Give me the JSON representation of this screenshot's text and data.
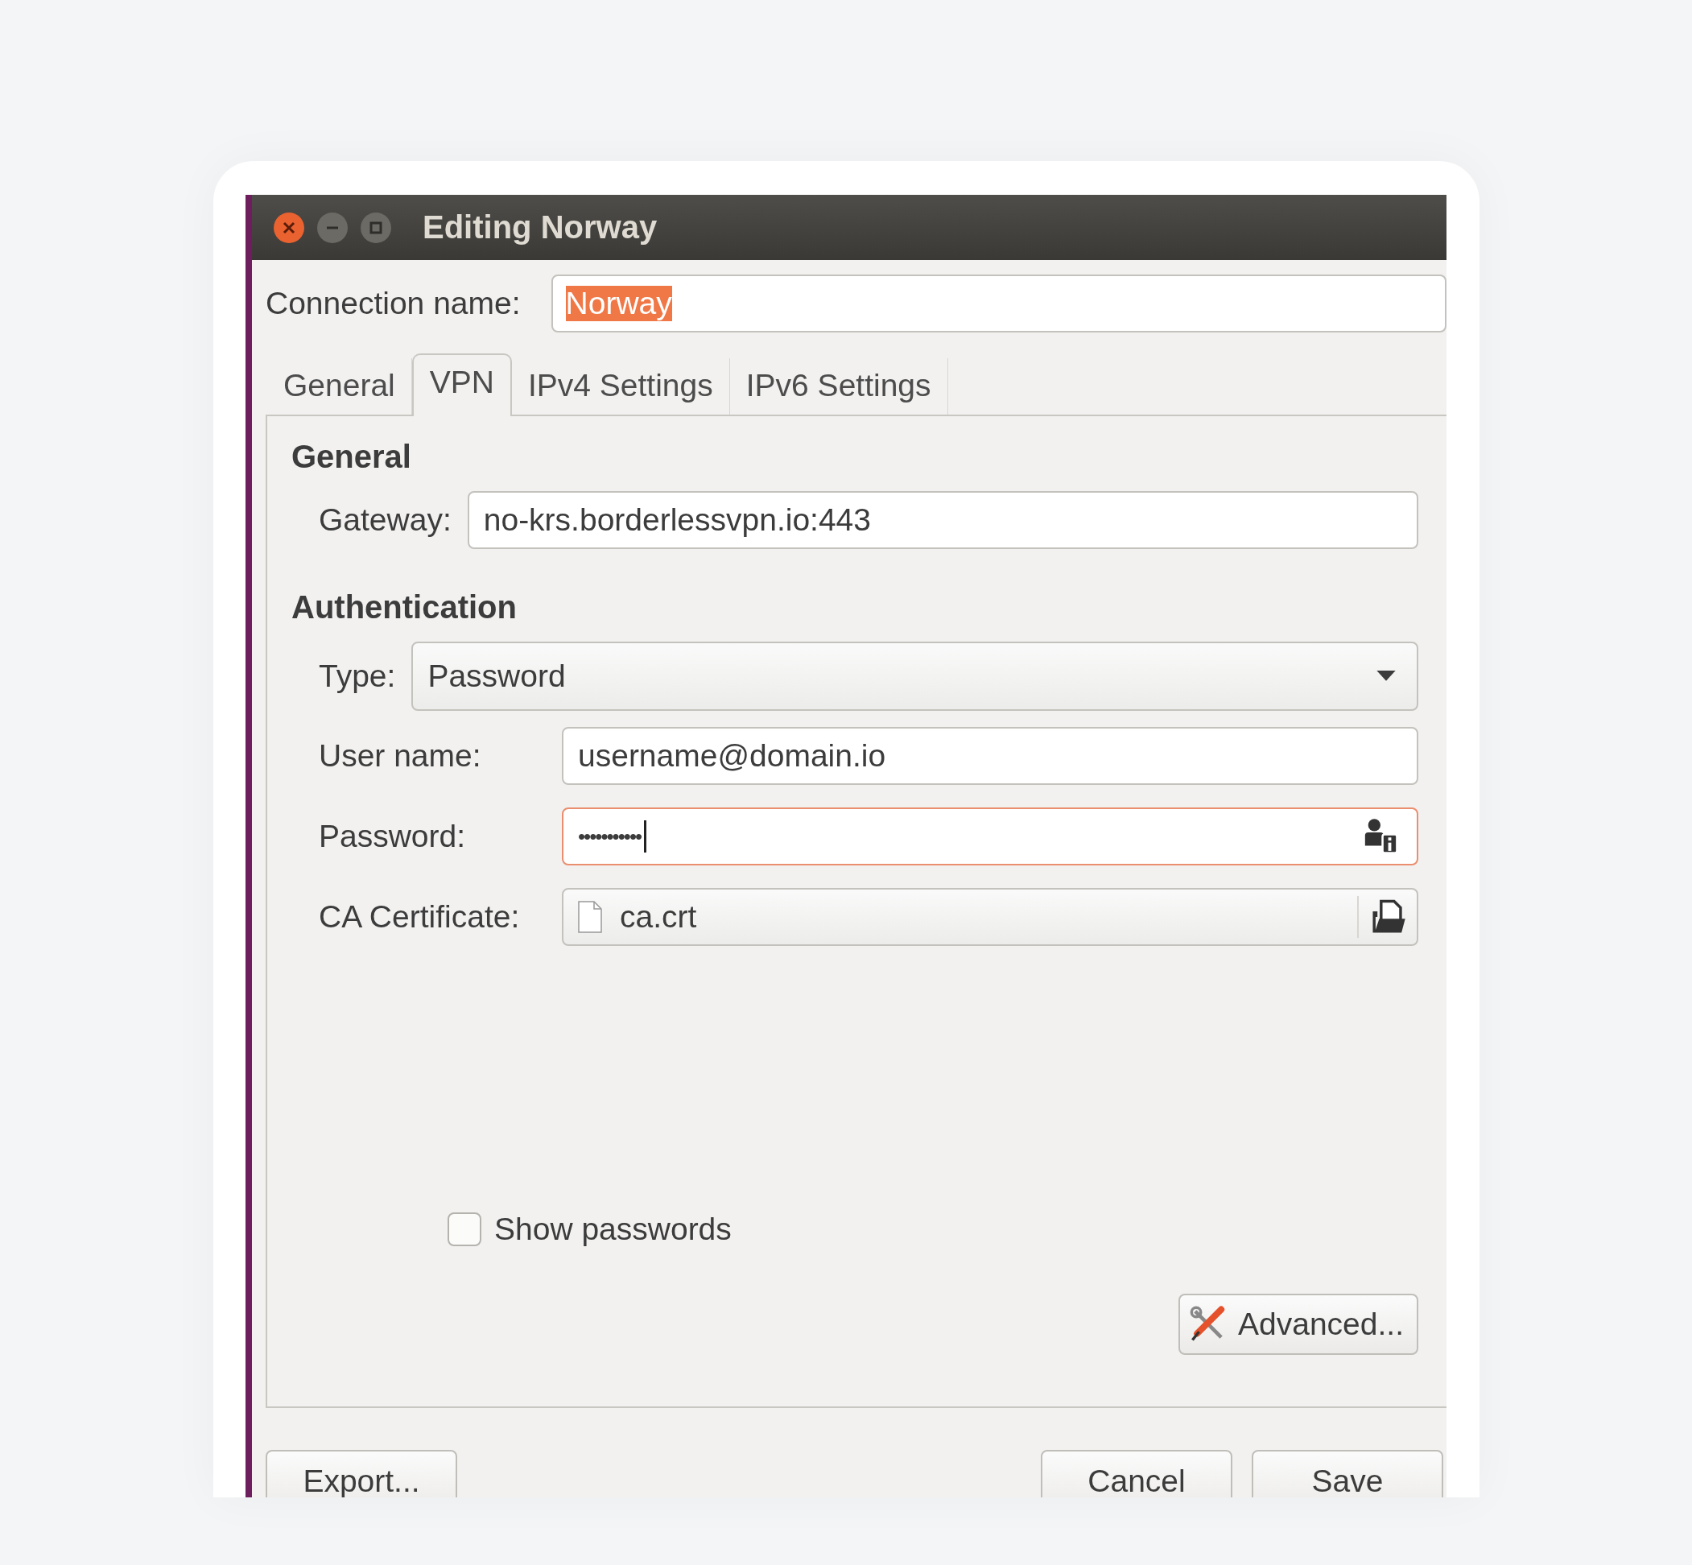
{
  "window": {
    "title": "Editing Norway"
  },
  "connection_name": {
    "label": "Connection name:",
    "value": "Norway",
    "text_selected": true
  },
  "tabs": [
    {
      "label": "General",
      "selected": false
    },
    {
      "label": "VPN",
      "selected": true
    },
    {
      "label": "IPv4 Settings",
      "selected": false
    },
    {
      "label": "IPv6 Settings",
      "selected": false
    }
  ],
  "general": {
    "heading": "General",
    "gateway": {
      "label": "Gateway:",
      "value": "no-krs.borderlessvpn.io:443"
    }
  },
  "authentication": {
    "heading": "Authentication",
    "type": {
      "label": "Type:",
      "value": "Password"
    },
    "user_name": {
      "label": "User name:",
      "value": "username@domain.io"
    },
    "password": {
      "label": "Password:",
      "value": "•••••••••••",
      "focused": true
    },
    "ca_certificate": {
      "label": "CA Certificate:",
      "value": "ca.crt"
    }
  },
  "show_passwords": {
    "label": "Show passwords",
    "checked": false
  },
  "advanced_button": "Advanced...",
  "footer_buttons": [
    "Export...",
    "Cancel",
    "Save"
  ]
}
